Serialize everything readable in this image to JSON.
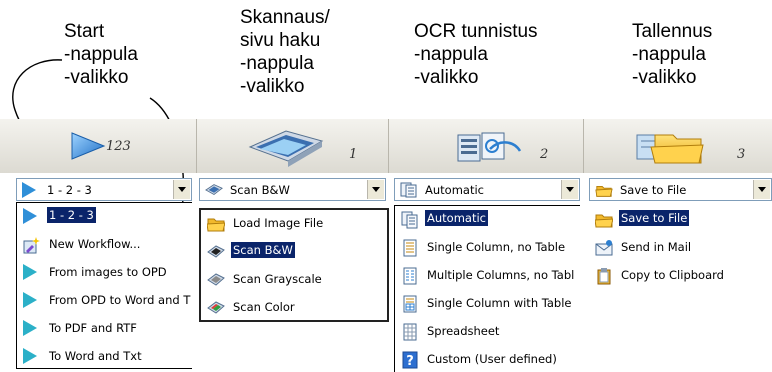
{
  "captions": [
    {
      "lines": [
        "Start",
        "-nappula",
        "-valikko"
      ]
    },
    {
      "lines": [
        "Skannaus/",
        "sivu haku",
        "-nappula",
        "-valikko"
      ]
    },
    {
      "lines": [
        "OCR tunnistus",
        "-nappula",
        "-valikko"
      ]
    },
    {
      "lines": [
        "Tallennus",
        "-nappula",
        "-valikko"
      ]
    }
  ],
  "toolbar": {
    "start": {
      "number": "123",
      "icon": "play-icon"
    },
    "scan": {
      "number": "1",
      "icon": "scanner-icon"
    },
    "ocr": {
      "number": "2",
      "icon": "ocr-icon"
    },
    "save": {
      "number": "3",
      "icon": "folder-icon"
    }
  },
  "combos": {
    "start": {
      "value": "1 - 2 - 3"
    },
    "scan": {
      "value": "Scan B&W"
    },
    "ocr": {
      "value": "Automatic"
    },
    "save": {
      "value": "Save to File"
    }
  },
  "menus": {
    "start": [
      "1 - 2 - 3",
      "New Workflow...",
      "From images to OPD",
      "From OPD to Word and T",
      "To PDF and RTF",
      "To Word and Txt"
    ],
    "scan": [
      "Load Image File",
      "Scan B&W",
      "Scan Grayscale",
      "Scan Color"
    ],
    "ocr": [
      "Automatic",
      "Single Column, no Table",
      "Multiple Columns, no Tabl",
      "Single Column with Table",
      "Spreadsheet",
      "Custom (User defined)"
    ],
    "save": [
      "Save to File",
      "Send in Mail",
      "Copy to Clipboard"
    ]
  },
  "colors": {
    "selection": "#0a246a",
    "accent": "#2f8fd8"
  }
}
